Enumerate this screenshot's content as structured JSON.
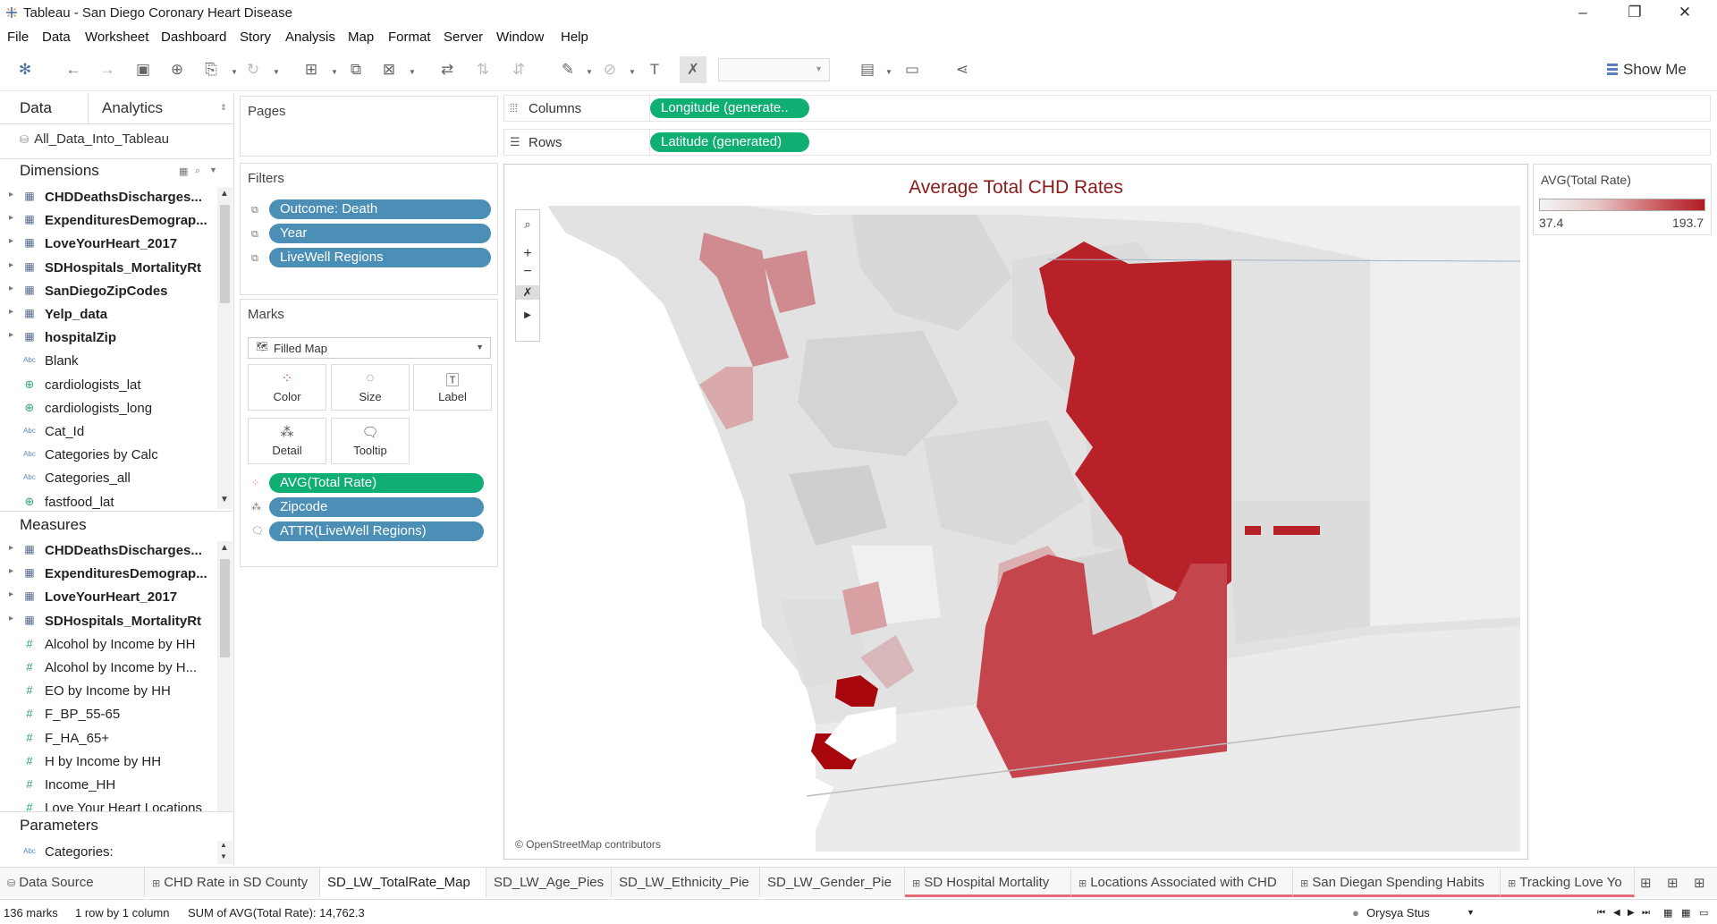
{
  "window": {
    "title": "Tableau - San Diego Coronary Heart Disease"
  },
  "menu": [
    "File",
    "Data",
    "Worksheet",
    "Dashboard",
    "Story",
    "Analysis",
    "Map",
    "Format",
    "Server",
    "Window",
    "Help"
  ],
  "toolbar": {
    "show_me": "Show Me"
  },
  "datapane": {
    "tab_data": "Data",
    "tab_analytics": "Analytics",
    "datasource": "All_Data_Into_Tableau",
    "dimensions_title": "Dimensions",
    "dimensions": [
      {
        "name": "CHDDeathsDischarges...",
        "kind": "table"
      },
      {
        "name": "ExpendituresDemograp...",
        "kind": "table"
      },
      {
        "name": "LoveYourHeart_2017",
        "kind": "table"
      },
      {
        "name": "SDHospitals_MortalityRt",
        "kind": "table"
      },
      {
        "name": "SanDiegoZipCodes",
        "kind": "table"
      },
      {
        "name": "Yelp_data",
        "kind": "table"
      },
      {
        "name": "hospitalZip",
        "kind": "table"
      },
      {
        "name": "Blank",
        "kind": "abc"
      },
      {
        "name": "cardiologists_lat",
        "kind": "geo"
      },
      {
        "name": "cardiologists_long",
        "kind": "geo"
      },
      {
        "name": "Cat_Id",
        "kind": "abc"
      },
      {
        "name": "Categories by Calc",
        "kind": "abc"
      },
      {
        "name": "Categories_all",
        "kind": "abc"
      },
      {
        "name": "fastfood_lat",
        "kind": "geo"
      }
    ],
    "measures_title": "Measures",
    "measures": [
      {
        "name": "CHDDeathsDischarges...",
        "kind": "table"
      },
      {
        "name": "ExpendituresDemograp...",
        "kind": "table"
      },
      {
        "name": "LoveYourHeart_2017",
        "kind": "table"
      },
      {
        "name": "SDHospitals_MortalityRt",
        "kind": "table"
      },
      {
        "name": "Alcohol by Income by HH",
        "kind": "hash"
      },
      {
        "name": "Alcohol by Income by H...",
        "kind": "hash"
      },
      {
        "name": "EO by Income by HH",
        "kind": "hash"
      },
      {
        "name": "F_BP_55-65",
        "kind": "hash"
      },
      {
        "name": "F_HA_65+",
        "kind": "hash"
      },
      {
        "name": "H by Income by HH",
        "kind": "hash"
      },
      {
        "name": "Income_HH",
        "kind": "hash"
      },
      {
        "name": "Love Your Heart Locations",
        "kind": "hash"
      }
    ],
    "parameters_title": "Parameters",
    "parameters": [
      {
        "name": "Categories:",
        "kind": "abc"
      }
    ]
  },
  "pages": {
    "title": "Pages"
  },
  "filters": {
    "title": "Filters",
    "items": [
      "Outcome: Death",
      "Year",
      "LiveWell Regions"
    ]
  },
  "marks": {
    "title": "Marks",
    "mark_type": "Filled Map",
    "buttons": [
      "Color",
      "Size",
      "Label",
      "Detail",
      "Tooltip"
    ],
    "fields": [
      "AVG(Total Rate)",
      "Zipcode",
      "ATTR(LiveWell Regions)"
    ]
  },
  "shelves": {
    "columns_label": "Columns",
    "columns_pill": "Longitude (generate..",
    "rows_label": "Rows",
    "rows_pill": "Latitude (generated)"
  },
  "viz": {
    "title": "Average Total CHD Rates",
    "attribution": "© OpenStreetMap contributors"
  },
  "legend": {
    "title": "AVG(Total Rate)",
    "min": "37.4",
    "max": "193.7",
    "colors": [
      "#f4f4f4",
      "#b21b22"
    ]
  },
  "sheet_tabs": [
    "Data Source",
    "CHD Rate in SD County",
    "SD_LW_TotalRate_Map",
    "SD_LW_Age_Pies",
    "SD_LW_Ethnicity_Pie",
    "SD_LW_Gender_Pie",
    "SD Hospital Mortality",
    "Locations Associated with CHD",
    "San Diegan Spending Habits",
    "Tracking Love Yo"
  ],
  "status": {
    "marks": "136 marks",
    "rows": "1 row by 1 column",
    "sum": "SUM of AVG(Total Rate): 14,762.3",
    "user": "Orysya Stus"
  }
}
